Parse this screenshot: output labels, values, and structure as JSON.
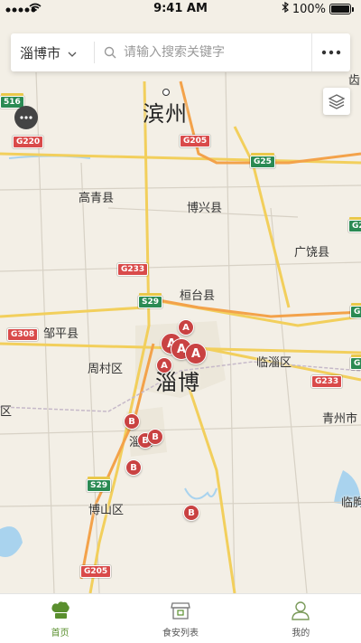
{
  "status_bar": {
    "time": "9:41 AM",
    "battery": "100%"
  },
  "search": {
    "city": "淄博市",
    "placeholder": "请输入搜索关键字",
    "more_icon": "more-icon"
  },
  "map": {
    "major_cities": [
      "滨州",
      "淄博"
    ],
    "labels": [
      "高青县",
      "博兴县",
      "广饶县",
      "桓台县",
      "邹平县",
      "周村区",
      "临淄区",
      "青州市",
      "博山区",
      "临朐",
      "区",
      "淄区",
      "齿"
    ],
    "road_shields": [
      "G205",
      "G25",
      "G220",
      "G233",
      "S29",
      "G308",
      "G233",
      "S29",
      "G205",
      "516",
      "G2",
      "G",
      "G"
    ],
    "markers": [
      "A",
      "A",
      "A",
      "A",
      "A",
      "B",
      "B",
      "B",
      "B",
      "B"
    ]
  },
  "tabs": [
    {
      "label": "首页",
      "icon": "chef-hat-icon",
      "active": true
    },
    {
      "label": "食安列表",
      "icon": "storefront-icon",
      "active": false
    },
    {
      "label": "我的",
      "icon": "user-icon",
      "active": false
    }
  ],
  "colors": {
    "accent": "#5a8f2e",
    "marker": "#c94242",
    "map_background": "#f3efe6",
    "highway_shield": "#2a8a53",
    "national_road_shield": "#d94a4a"
  }
}
